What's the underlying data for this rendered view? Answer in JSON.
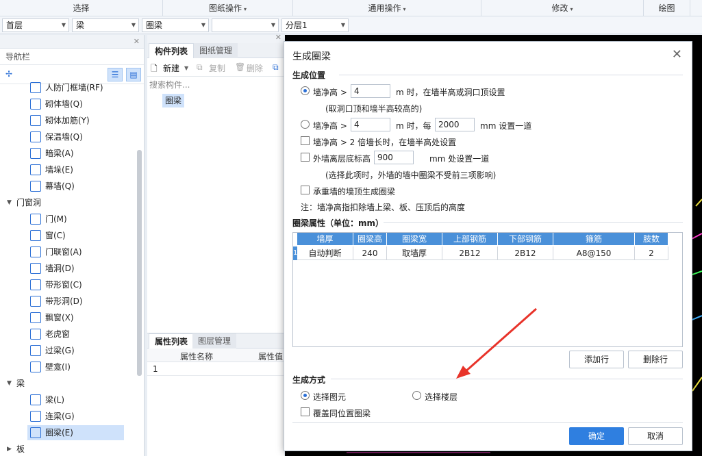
{
  "ribbon": {
    "groups": [
      {
        "label": "选择",
        "caret": ""
      },
      {
        "label": "图纸操作",
        "caret": "▾"
      },
      {
        "label": "通用操作",
        "caret": "▾"
      },
      {
        "label": "修改",
        "caret": "▾"
      },
      {
        "label": "绘图",
        "caret": ""
      }
    ]
  },
  "selectors": {
    "floor": "首层",
    "category": "梁",
    "type": "圈梁",
    "item": "",
    "layer": "分层1"
  },
  "nav": {
    "title": "导航栏",
    "items_top": [
      {
        "label": "人防门框墙(RF)"
      },
      {
        "label": "砌体墙(Q)"
      },
      {
        "label": "砌体加筋(Y)"
      },
      {
        "label": "保温墙(Q)"
      },
      {
        "label": "暗梁(A)"
      },
      {
        "label": "墙垛(E)"
      },
      {
        "label": "幕墙(Q)"
      }
    ],
    "cat_door": "门窗洞",
    "items_door": [
      {
        "label": "门(M)"
      },
      {
        "label": "窗(C)"
      },
      {
        "label": "门联窗(A)"
      },
      {
        "label": "墙洞(D)"
      },
      {
        "label": "带形窗(C)"
      },
      {
        "label": "带形洞(D)"
      },
      {
        "label": "飘窗(X)"
      },
      {
        "label": "老虎窗"
      },
      {
        "label": "过梁(G)"
      },
      {
        "label": "壁龛(I)"
      }
    ],
    "cat_beam": "梁",
    "items_beam": [
      {
        "label": "梁(L)"
      },
      {
        "label": "连梁(G)"
      },
      {
        "label": "圈梁(E)"
      }
    ],
    "cat_slab": "板"
  },
  "component": {
    "tab_list": "构件列表",
    "tab_drawings": "图纸管理",
    "new_label": "新建",
    "copy_label": "复制",
    "delete_label": "删除",
    "search_placeholder": "搜索构件...",
    "item": "圈梁"
  },
  "props": {
    "tab_attr": "属性列表",
    "tab_layer": "图层管理",
    "col_name": "属性名称",
    "col_value": "属性值",
    "row_num": "1"
  },
  "dialog": {
    "title": "生成圈梁",
    "sec_position": "生成位置",
    "opt1_prefix": "墙净高 >",
    "opt1_value": "4",
    "opt1_suffix": "m 时，在墙半高或洞口顶设置",
    "opt1_note": "(取洞口顶和墙半高较高的)",
    "opt2_prefix": "墙净高 >",
    "opt2_value": "4",
    "opt2_mid": "m 时，每",
    "opt2_value2": "2000",
    "opt2_suffix": "mm 设置一道",
    "opt3": "墙净高 > 2 倍墙长时，在墙半高处设置",
    "opt4_prefix": "外墙离层底标高",
    "opt4_value": "900",
    "opt4_suffix": "mm 处设置一道",
    "opt4_note": "(选择此项时，外墙的墙中圈梁不受前三项影响)",
    "opt5": "承重墙的墙顶生成圈梁",
    "note": "注：墙净高指扣除墙上梁、板、压顶后的高度",
    "sec_props": "圈梁属性（单位：mm）",
    "grid": {
      "headers": [
        "墙厚",
        "圈梁高",
        "圈梁宽",
        "上部钢筋",
        "下部钢筋",
        "箍筋",
        "肢数"
      ],
      "row_index": "1",
      "row": [
        "自动判断",
        "240",
        "取墙厚",
        "2B12",
        "2B12",
        "A8@150",
        "2"
      ]
    },
    "add_row": "添加行",
    "delete_row": "删除行",
    "sec_method": "生成方式",
    "method_elem": "选择图元",
    "method_floor": "选择楼层",
    "overwrite": "覆盖同位置圈梁",
    "ok": "确定",
    "cancel": "取消"
  },
  "colors": {
    "accent": "#2f7fe0",
    "grid_header": "#4a90d9",
    "arrow": "#e8332a"
  }
}
